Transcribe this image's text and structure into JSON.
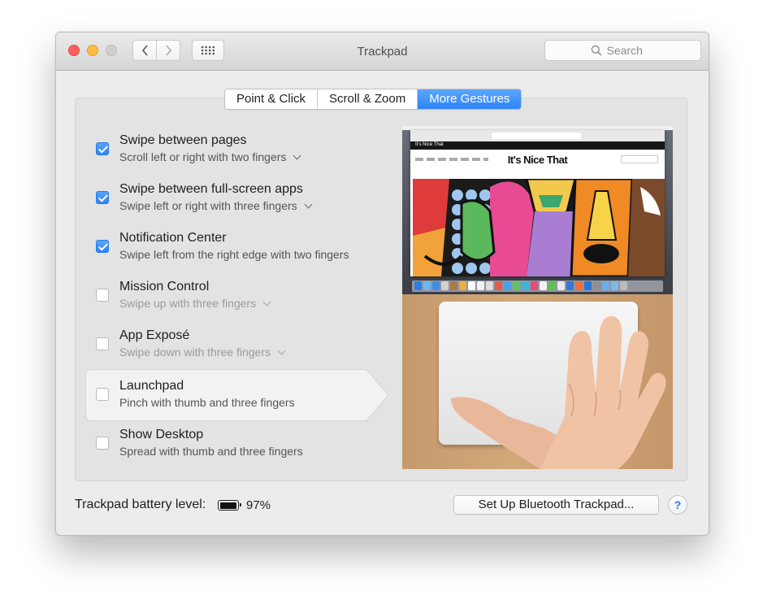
{
  "window": {
    "title": "Trackpad"
  },
  "search": {
    "placeholder": "Search"
  },
  "tabs": [
    {
      "label": "Point & Click",
      "active": false
    },
    {
      "label": "Scroll & Zoom",
      "active": false
    },
    {
      "label": "More Gestures",
      "active": true
    }
  ],
  "gestures": [
    {
      "title": "Swipe between pages",
      "subtitle": "Scroll left or right with two fingers",
      "checked": true,
      "has_menu": true,
      "dimmed": false
    },
    {
      "title": "Swipe between full-screen apps",
      "subtitle": "Swipe left or right with three fingers",
      "checked": true,
      "has_menu": true,
      "dimmed": false
    },
    {
      "title": "Notification Center",
      "subtitle": "Swipe left from the right edge with two fingers",
      "checked": true,
      "has_menu": false,
      "dimmed": false
    },
    {
      "title": "Mission Control",
      "subtitle": "Swipe up with three fingers",
      "checked": false,
      "has_menu": true,
      "dimmed": true
    },
    {
      "title": "App Exposé",
      "subtitle": "Swipe down with three fingers",
      "checked": false,
      "has_menu": true,
      "dimmed": true
    },
    {
      "title": "Launchpad",
      "subtitle": "Pinch with thumb and three fingers",
      "checked": false,
      "has_menu": false,
      "dimmed": false,
      "selected": true
    },
    {
      "title": "Show Desktop",
      "subtitle": "Spread with thumb and three fingers",
      "checked": false,
      "has_menu": false,
      "dimmed": false
    }
  ],
  "preview": {
    "site_title": "It's Nice That",
    "site_bar_text": "It's Nice That"
  },
  "footer": {
    "battery_label": "Trackpad battery level:",
    "battery_percent": "97%",
    "battery_level": 0.97,
    "setup_button": "Set Up Bluetooth Trackpad...",
    "help_button": "?"
  },
  "colors": {
    "accent": "#2f84f6",
    "close": "#fc615d",
    "minimize": "#fdbc40"
  }
}
